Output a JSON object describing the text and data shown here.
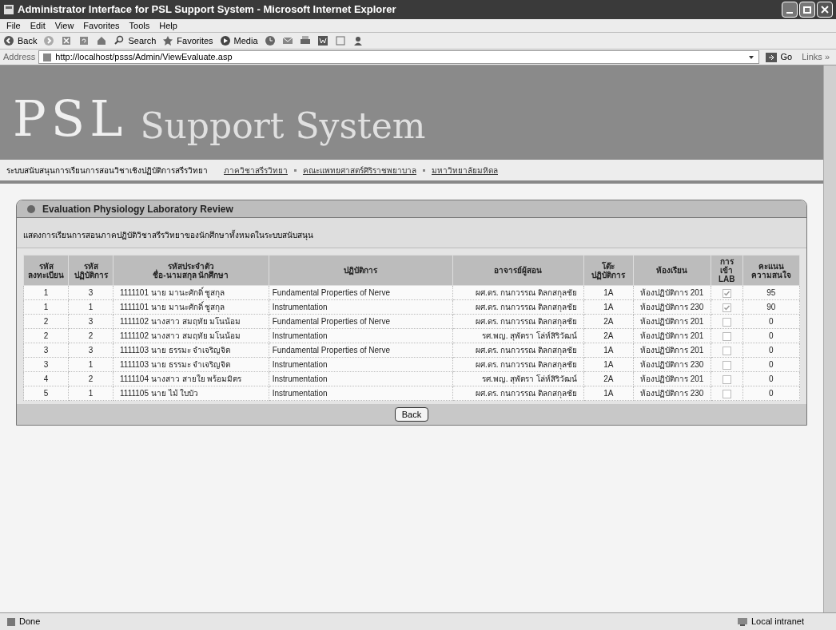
{
  "window": {
    "title": "Administrator Interface for PSL Support System - Microsoft Internet Explorer"
  },
  "menu": [
    "File",
    "Edit",
    "View",
    "Favorites",
    "Tools",
    "Help"
  ],
  "toolbar": [
    {
      "kind": "back",
      "label": "Back"
    },
    {
      "kind": "forward"
    },
    {
      "kind": "stop"
    },
    {
      "kind": "refresh"
    },
    {
      "kind": "home"
    },
    {
      "kind": "search",
      "label": "Search"
    },
    {
      "kind": "favorites",
      "label": "Favorites"
    },
    {
      "kind": "media",
      "label": "Media"
    },
    {
      "kind": "history"
    },
    {
      "kind": "mail"
    },
    {
      "kind": "print"
    },
    {
      "kind": "word"
    },
    {
      "kind": "discuss"
    },
    {
      "kind": "messenger"
    }
  ],
  "address": {
    "label": "Address",
    "value": "http://localhost/psss/Admin/ViewEvaluate.asp",
    "go": "Go",
    "links": "Links »"
  },
  "banner": {
    "logo": "PSL",
    "subtitle": "Support System"
  },
  "nav": {
    "title": "ระบบสนับสนุนการเรียนการสอนวิชาเชิงปฏิบัติการสรีรวิทยา",
    "links": [
      "ภาควิชาสรีรวิทยา",
      "คณะแพทยศาสตร์ศิริราชพยาบาล",
      "มหาวิทยาลัยมหิดล"
    ]
  },
  "panel": {
    "title": "Evaluation Physiology Laboratory Review",
    "description": "แสดงการเรียนการสอนภาคปฏิบัติวิชาสรีรวิทยาของนักศึกษาทั้งหมดในระบบสนับสนุน",
    "table": {
      "columns": [
        [
          "รหัส",
          "ลงทะเบียน"
        ],
        [
          "รหัส",
          "ปฏิบัติการ"
        ],
        [
          "รหัสประจำตัว",
          "ชื่อ-นามสกุล นักศึกษา"
        ],
        [
          "ปฏิบัติการ"
        ],
        [
          "อาจารย์ผู้สอน"
        ],
        [
          "โต๊ะ",
          "ปฏิบัติการ"
        ],
        [
          "ห้องเรียน"
        ],
        [
          "การเข้า",
          "LAB"
        ],
        [
          "คะแนน",
          "ความสนใจ"
        ]
      ],
      "rows": [
        {
          "reg": "1",
          "lab": "3",
          "student": "1111101 นาย มานะศักดิ์ ชูสกุล",
          "experiment": "Fundamental Properties of Nerve",
          "teacher": "ผศ.ดร. กนกวรรณ ติลกสกุลชัย",
          "table": "1A",
          "room": "ห้องปฏิบัติการ 201",
          "attended": true,
          "score": "95"
        },
        {
          "reg": "1",
          "lab": "1",
          "student": "1111101 นาย มานะศักดิ์ ชูสกุล",
          "experiment": "Instrumentation",
          "teacher": "ผศ.ดร. กนกวรรณ ติลกสกุลชัย",
          "table": "1A",
          "room": "ห้องปฏิบัติการ 230",
          "attended": true,
          "score": "90"
        },
        {
          "reg": "2",
          "lab": "3",
          "student": "1111102 นางสาว สมฤทัย มโนน้อม",
          "experiment": "Fundamental Properties of Nerve",
          "teacher": "ผศ.ดร. กนกวรรณ ติลกสกุลชัย",
          "table": "2A",
          "room": "ห้องปฏิบัติการ 201",
          "attended": false,
          "score": "0"
        },
        {
          "reg": "2",
          "lab": "2",
          "student": "1111102 นางสาว สมฤทัย มโนน้อม",
          "experiment": "Instrumentation",
          "teacher": "รศ.พญ. สุพัตรา โล่ห์สิริวัฒน์",
          "table": "2A",
          "room": "ห้องปฏิบัติการ 201",
          "attended": false,
          "score": "0"
        },
        {
          "reg": "3",
          "lab": "3",
          "student": "1111103 นาย ธรรมะ จำเจริญจิต",
          "experiment": "Fundamental Properties of Nerve",
          "teacher": "ผศ.ดร. กนกวรรณ ติลกสกุลชัย",
          "table": "1A",
          "room": "ห้องปฏิบัติการ 201",
          "attended": false,
          "score": "0"
        },
        {
          "reg": "3",
          "lab": "1",
          "student": "1111103 นาย ธรรมะ จำเจริญจิต",
          "experiment": "Instrumentation",
          "teacher": "ผศ.ดร. กนกวรรณ ติลกสกุลชัย",
          "table": "1A",
          "room": "ห้องปฏิบัติการ 230",
          "attended": false,
          "score": "0"
        },
        {
          "reg": "4",
          "lab": "2",
          "student": "1111104 นางสาว สายใย พร้อมมิตร",
          "experiment": "Instrumentation",
          "teacher": "รศ.พญ. สุพัตรา โล่ห์สิริวัฒน์",
          "table": "2A",
          "room": "ห้องปฏิบัติการ 201",
          "attended": false,
          "score": "0"
        },
        {
          "reg": "5",
          "lab": "1",
          "student": "1111105 นาย ไม้ ใบบัว",
          "experiment": "Instrumentation",
          "teacher": "ผศ.ดร. กนกวรรณ ติลกสกุลชัย",
          "table": "1A",
          "room": "ห้องปฏิบัติการ 230",
          "attended": false,
          "score": "0"
        }
      ]
    },
    "back_button": "Back"
  },
  "status_bar": {
    "text": "Done",
    "zone": "Local intranet"
  }
}
